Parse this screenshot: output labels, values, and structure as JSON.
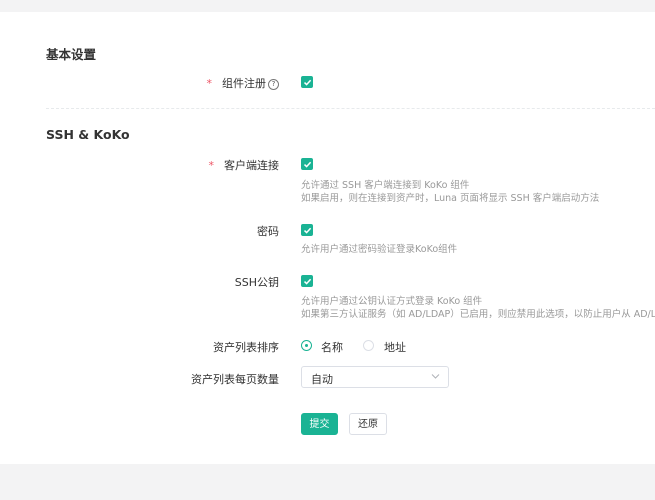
{
  "sections": {
    "basic": {
      "title": "基本设置"
    },
    "ssh": {
      "title": "SSH & KoKo"
    }
  },
  "fields": {
    "component_registration": {
      "required_mark": "*",
      "label": "组件注册",
      "help_icon": "question-circle-icon",
      "checked": true
    },
    "client_connect": {
      "required_mark": "*",
      "label": "客户端连接",
      "checked": true,
      "help_lines": [
        "允许通过 SSH 客户端连接到 KoKo 组件",
        "如果启用，则在连接到资产时，Luna 页面将显示 SSH 客户端启动方法"
      ]
    },
    "password": {
      "label": "密码",
      "checked": true,
      "help_lines": [
        "允许用户通过密码验证登录KoKo组件"
      ]
    },
    "ssh_key": {
      "label": "SSH公钥",
      "checked": true,
      "help_lines": [
        "允许用户通过公钥认证方式登录 KoKo 组件",
        "如果第三方认证服务（如 AD/LDAP）已启用，则应禁用此选项，以防止用户从 AD/LDAP"
      ]
    },
    "asset_sort": {
      "label": "资产列表排序",
      "options": [
        {
          "label": "名称",
          "selected": true
        },
        {
          "label": "地址",
          "selected": false
        }
      ]
    },
    "page_size": {
      "label": "资产列表每页数量",
      "value": "自动",
      "icon": "chevron-down-icon"
    }
  },
  "actions": {
    "submit": "提交",
    "reset": "还原"
  },
  "colors": {
    "accent": "#1ab394",
    "required": "#ed5565"
  }
}
